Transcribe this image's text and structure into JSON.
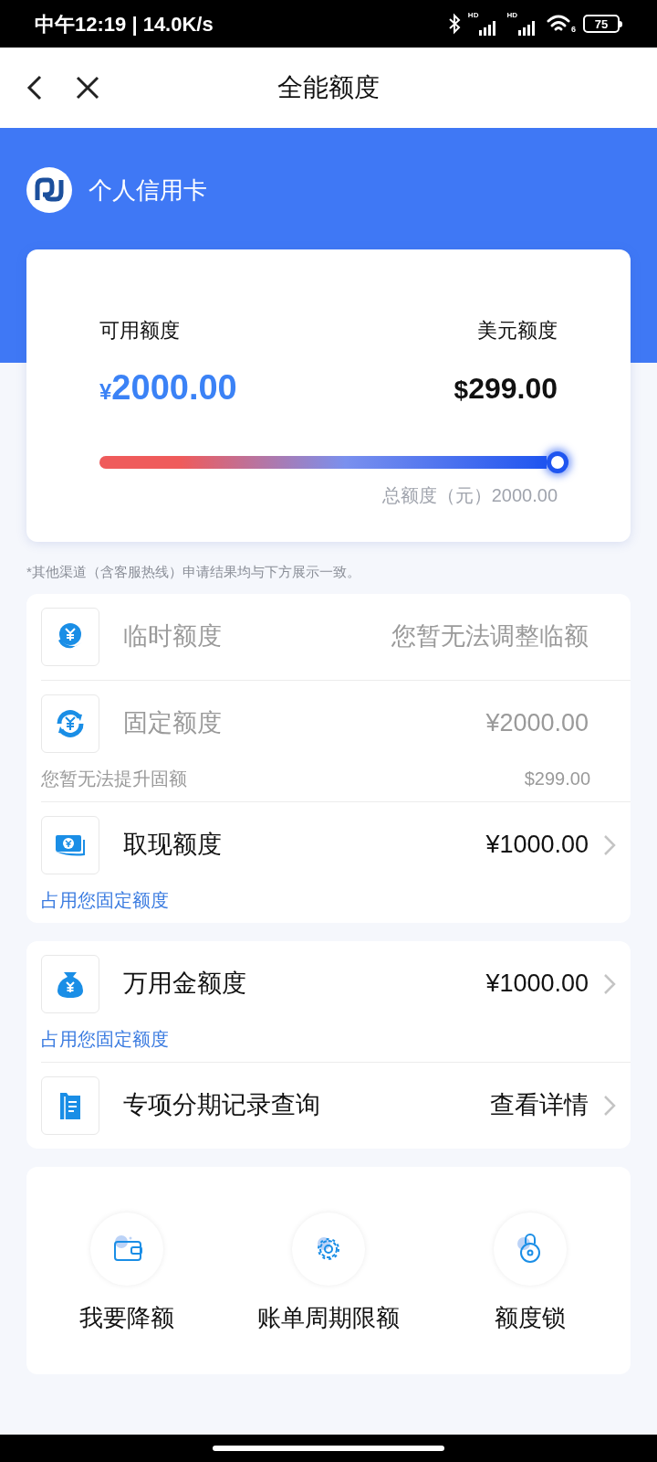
{
  "status_bar": {
    "time": "中午12:19 | 14.0K/s",
    "signals": [
      {
        "label": "HD"
      },
      {
        "label": "HD"
      }
    ],
    "wifi_label": "6",
    "battery": "75"
  },
  "header": {
    "title": "全能额度"
  },
  "banner": {
    "title": "个人信用卡"
  },
  "summary": {
    "available_label": "可用额度",
    "available_currency": "¥",
    "available_value": "2000.00",
    "usd_label": "美元额度",
    "usd_currency": "$",
    "usd_value": "299.00",
    "level": 1,
    "total": "总额度（元）2000.00"
  },
  "notice": "*其他渠道（含客服热线）申请结果均与下方展示一致。",
  "cards": [
    {
      "rows": [
        {
          "label": "临时额度",
          "value": "您暂无法调整临额",
          "disabled": true,
          "chevron": false
        },
        {
          "label": "固定额度",
          "value": "¥2000.00",
          "note": "您暂无法提升固额",
          "note_value": "$299.00",
          "disabled": true,
          "chevron": false
        },
        {
          "label": "取现额度",
          "value": "¥1000.00",
          "note": "占用您固定额度",
          "disabled": false,
          "chevron": true
        }
      ]
    },
    {
      "rows": [
        {
          "label": "万用金额度",
          "value": "¥1000.00",
          "note": "占用您固定额度",
          "disabled": false,
          "chevron": true
        },
        {
          "label": "专项分期记录查询",
          "value": "查看详情",
          "disabled": false,
          "chevron": true
        }
      ]
    }
  ],
  "actions": [
    {
      "label": "我要降额"
    },
    {
      "label": "账单周期限额"
    },
    {
      "label": "额度锁"
    }
  ]
}
